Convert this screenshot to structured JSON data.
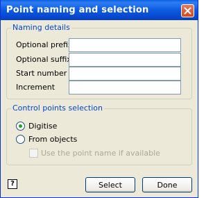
{
  "window": {
    "title": "Point naming and selection"
  },
  "naming": {
    "legend": "Naming details",
    "fields": [
      {
        "label": "Optional prefix",
        "value": ""
      },
      {
        "label": "Optional suffix",
        "value": ""
      },
      {
        "label": "Start number",
        "value": ""
      },
      {
        "label": "Increment",
        "value": ""
      }
    ]
  },
  "selection": {
    "legend": "Control points selection",
    "options": [
      {
        "label": "Digitise",
        "selected": true
      },
      {
        "label": "From objects",
        "selected": false
      }
    ],
    "use_point_name": {
      "label": "Use the point name if available",
      "checked": false,
      "enabled": false
    }
  },
  "buttons": {
    "select_label": "Select",
    "done_label": "Done"
  },
  "help": {
    "glyph": "?"
  },
  "icons": {
    "close": "close-icon",
    "help": "help-icon",
    "radio_dot_color": "#21a121"
  }
}
